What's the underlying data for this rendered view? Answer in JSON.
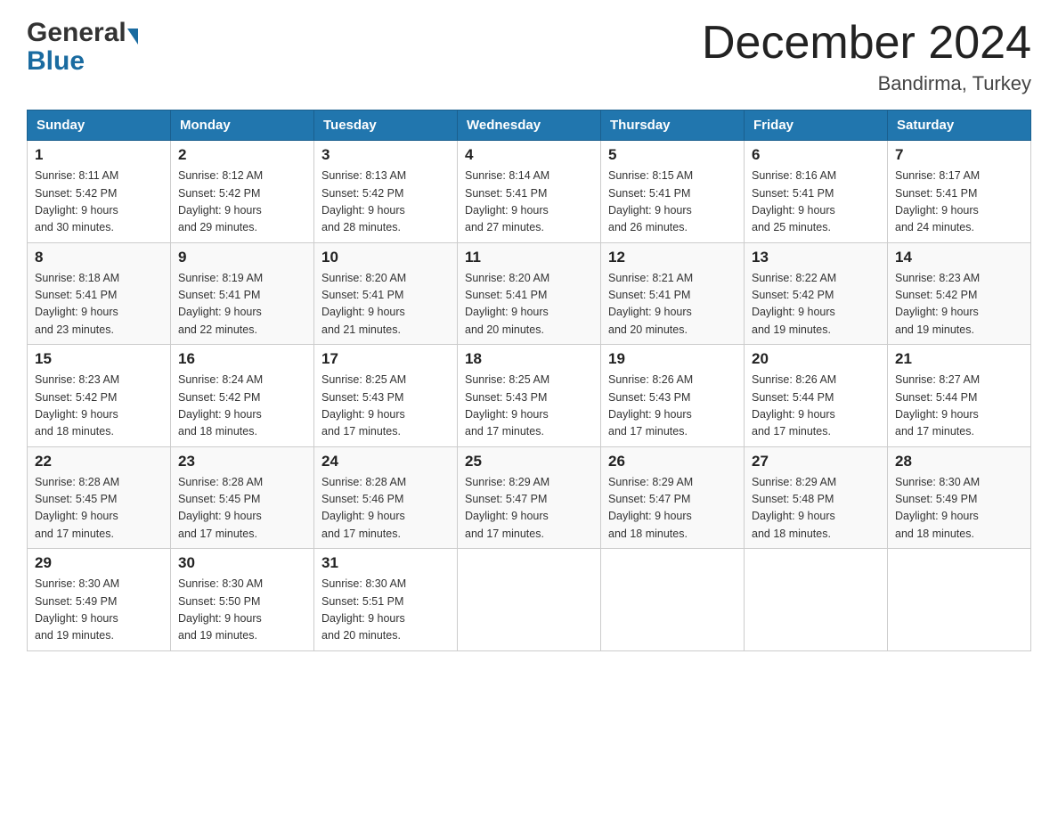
{
  "header": {
    "logo_general": "General",
    "logo_blue": "Blue",
    "month_title": "December 2024",
    "location": "Bandirma, Turkey"
  },
  "days_of_week": [
    "Sunday",
    "Monday",
    "Tuesday",
    "Wednesday",
    "Thursday",
    "Friday",
    "Saturday"
  ],
  "weeks": [
    [
      {
        "day": "1",
        "sunrise": "8:11 AM",
        "sunset": "5:42 PM",
        "daylight": "9 hours and 30 minutes."
      },
      {
        "day": "2",
        "sunrise": "8:12 AM",
        "sunset": "5:42 PM",
        "daylight": "9 hours and 29 minutes."
      },
      {
        "day": "3",
        "sunrise": "8:13 AM",
        "sunset": "5:42 PM",
        "daylight": "9 hours and 28 minutes."
      },
      {
        "day": "4",
        "sunrise": "8:14 AM",
        "sunset": "5:41 PM",
        "daylight": "9 hours and 27 minutes."
      },
      {
        "day": "5",
        "sunrise": "8:15 AM",
        "sunset": "5:41 PM",
        "daylight": "9 hours and 26 minutes."
      },
      {
        "day": "6",
        "sunrise": "8:16 AM",
        "sunset": "5:41 PM",
        "daylight": "9 hours and 25 minutes."
      },
      {
        "day": "7",
        "sunrise": "8:17 AM",
        "sunset": "5:41 PM",
        "daylight": "9 hours and 24 minutes."
      }
    ],
    [
      {
        "day": "8",
        "sunrise": "8:18 AM",
        "sunset": "5:41 PM",
        "daylight": "9 hours and 23 minutes."
      },
      {
        "day": "9",
        "sunrise": "8:19 AM",
        "sunset": "5:41 PM",
        "daylight": "9 hours and 22 minutes."
      },
      {
        "day": "10",
        "sunrise": "8:20 AM",
        "sunset": "5:41 PM",
        "daylight": "9 hours and 21 minutes."
      },
      {
        "day": "11",
        "sunrise": "8:20 AM",
        "sunset": "5:41 PM",
        "daylight": "9 hours and 20 minutes."
      },
      {
        "day": "12",
        "sunrise": "8:21 AM",
        "sunset": "5:41 PM",
        "daylight": "9 hours and 20 minutes."
      },
      {
        "day": "13",
        "sunrise": "8:22 AM",
        "sunset": "5:42 PM",
        "daylight": "9 hours and 19 minutes."
      },
      {
        "day": "14",
        "sunrise": "8:23 AM",
        "sunset": "5:42 PM",
        "daylight": "9 hours and 19 minutes."
      }
    ],
    [
      {
        "day": "15",
        "sunrise": "8:23 AM",
        "sunset": "5:42 PM",
        "daylight": "9 hours and 18 minutes."
      },
      {
        "day": "16",
        "sunrise": "8:24 AM",
        "sunset": "5:42 PM",
        "daylight": "9 hours and 18 minutes."
      },
      {
        "day": "17",
        "sunrise": "8:25 AM",
        "sunset": "5:43 PM",
        "daylight": "9 hours and 17 minutes."
      },
      {
        "day": "18",
        "sunrise": "8:25 AM",
        "sunset": "5:43 PM",
        "daylight": "9 hours and 17 minutes."
      },
      {
        "day": "19",
        "sunrise": "8:26 AM",
        "sunset": "5:43 PM",
        "daylight": "9 hours and 17 minutes."
      },
      {
        "day": "20",
        "sunrise": "8:26 AM",
        "sunset": "5:44 PM",
        "daylight": "9 hours and 17 minutes."
      },
      {
        "day": "21",
        "sunrise": "8:27 AM",
        "sunset": "5:44 PM",
        "daylight": "9 hours and 17 minutes."
      }
    ],
    [
      {
        "day": "22",
        "sunrise": "8:28 AM",
        "sunset": "5:45 PM",
        "daylight": "9 hours and 17 minutes."
      },
      {
        "day": "23",
        "sunrise": "8:28 AM",
        "sunset": "5:45 PM",
        "daylight": "9 hours and 17 minutes."
      },
      {
        "day": "24",
        "sunrise": "8:28 AM",
        "sunset": "5:46 PM",
        "daylight": "9 hours and 17 minutes."
      },
      {
        "day": "25",
        "sunrise": "8:29 AM",
        "sunset": "5:47 PM",
        "daylight": "9 hours and 17 minutes."
      },
      {
        "day": "26",
        "sunrise": "8:29 AM",
        "sunset": "5:47 PM",
        "daylight": "9 hours and 18 minutes."
      },
      {
        "day": "27",
        "sunrise": "8:29 AM",
        "sunset": "5:48 PM",
        "daylight": "9 hours and 18 minutes."
      },
      {
        "day": "28",
        "sunrise": "8:30 AM",
        "sunset": "5:49 PM",
        "daylight": "9 hours and 18 minutes."
      }
    ],
    [
      {
        "day": "29",
        "sunrise": "8:30 AM",
        "sunset": "5:49 PM",
        "daylight": "9 hours and 19 minutes."
      },
      {
        "day": "30",
        "sunrise": "8:30 AM",
        "sunset": "5:50 PM",
        "daylight": "9 hours and 19 minutes."
      },
      {
        "day": "31",
        "sunrise": "8:30 AM",
        "sunset": "5:51 PM",
        "daylight": "9 hours and 20 minutes."
      },
      null,
      null,
      null,
      null
    ]
  ]
}
